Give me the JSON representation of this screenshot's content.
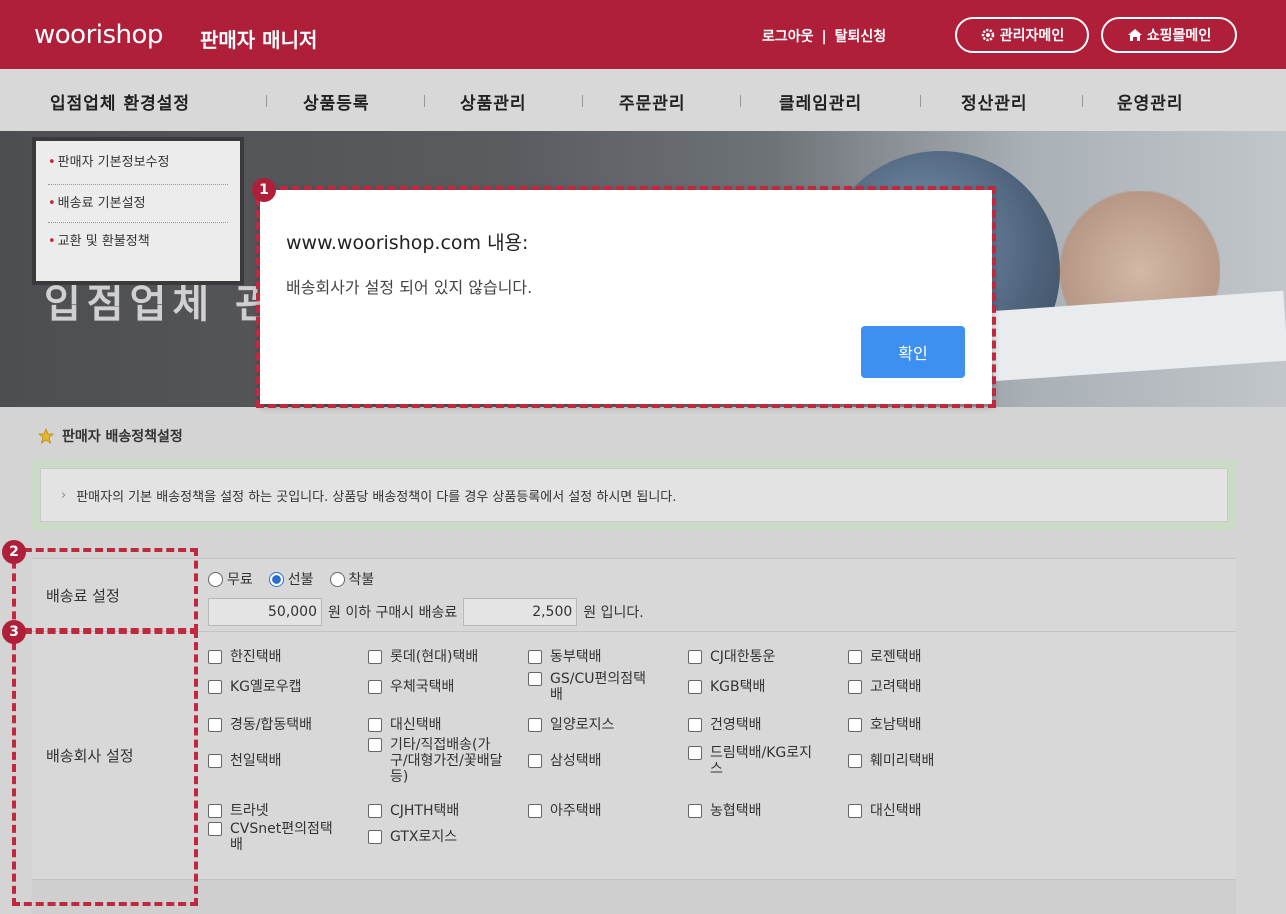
{
  "header": {
    "logo": "woorishop",
    "subtitle": "판매자 매니저",
    "logout": "로그아웃",
    "separator": "|",
    "withdraw": "탈퇴신청",
    "admin_main": "관리자메인",
    "shop_main": "쇼핑몰메인"
  },
  "nav": {
    "items": [
      "입점업체 환경설정",
      "상품등록",
      "상품관리",
      "주문관리",
      "클레임관리",
      "정산관리",
      "운영관리"
    ]
  },
  "banner": {
    "text": "입점업체 관리"
  },
  "submenu": {
    "items": [
      "판매자 기본정보수정",
      "배송료 기본설정",
      "교환 및 환불정책"
    ]
  },
  "dialog": {
    "title": "www.woorishop.com 내용:",
    "message": "배송회사가 설정 되어 있지 않습니다.",
    "ok": "확인"
  },
  "badges": [
    "1",
    "2",
    "3"
  ],
  "section": {
    "title": "판매자 배송정책설정",
    "info": "판매자의 기본 배송정책을 설정 하는 곳입니다. 상품당 배송정책이 다를 경우 상품등록에서 설정 하시면 됩니다."
  },
  "shipping_fee": {
    "label": "배송료 설정",
    "options": [
      "무료",
      "선불",
      "착불"
    ],
    "selected": "선불",
    "threshold": "50,000",
    "text_mid": "원 이하 구매시 배송료",
    "fee": "2,500",
    "text_end": "원 입니다."
  },
  "carriers": {
    "label": "배송회사 설정",
    "list": [
      "한진택배",
      "롯데(현대)택배",
      "동부택배",
      "CJ대한통운",
      "로젠택배",
      "KG옐로우캡",
      "우체국택배",
      "GS/CU편의점택\n배",
      "KGB택배",
      "고려택배",
      "경동/합동택배",
      "대신택배",
      "일양로지스",
      "건영택배",
      "호남택배",
      "천일택배",
      "기타/직접배송(가\n구/대형가전/꽃배달\n등)",
      "삼성택배",
      "드림택배/KG로지\n스",
      "훼미리택배",
      "트라넷",
      "CJHTH택배",
      "아주택배",
      "농협택배",
      "대신택배",
      "CVSnet편의점택\n배",
      "GTX로지스"
    ]
  },
  "colors": {
    "brand": "#b01f3a",
    "button": "#3d8ff0",
    "annotation": "#c0283e"
  }
}
